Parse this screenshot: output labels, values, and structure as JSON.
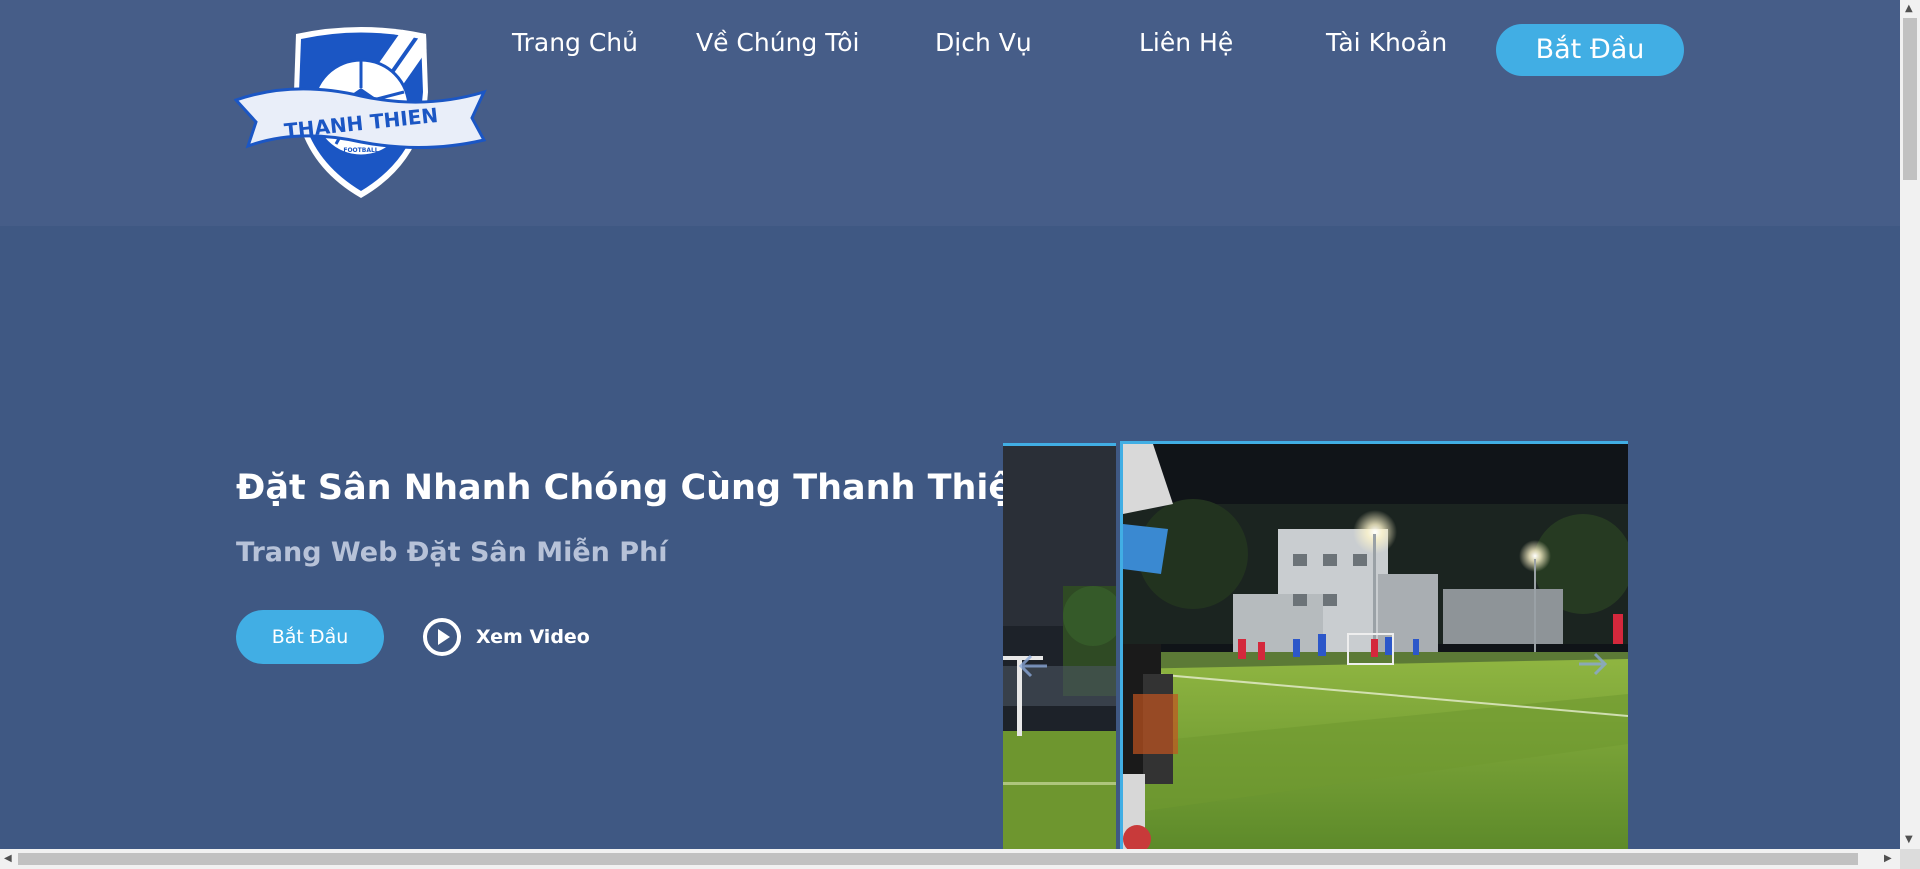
{
  "brand": {
    "logo_text": "THANH THIEN",
    "logo_subtext": "FOOTBALL"
  },
  "nav": {
    "items": [
      {
        "label": "Trang Chủ"
      },
      {
        "label": "Về Chúng Tôi"
      },
      {
        "label": "Dịch Vụ"
      },
      {
        "label": "Liên Hệ"
      },
      {
        "label": "Tài Khoản"
      }
    ],
    "cta_label": "Bắt Đầu"
  },
  "hero": {
    "title": "Đặt Sân Nhanh Chóng Cùng Thanh Thiện",
    "subtitle": "Trang Web Đặt Sân Miễn Phí",
    "primary_button": "Bắt Đầu",
    "video_link": "Xem Video",
    "video_icon": "play-circle-icon"
  },
  "carousel": {
    "prev_icon": "arrow-left-icon",
    "next_icon": "arrow-right-icon"
  },
  "colors": {
    "background": "#3f5883",
    "header": "#465d88",
    "accent": "#41aee4",
    "subtitle": "#b7c2d8"
  }
}
